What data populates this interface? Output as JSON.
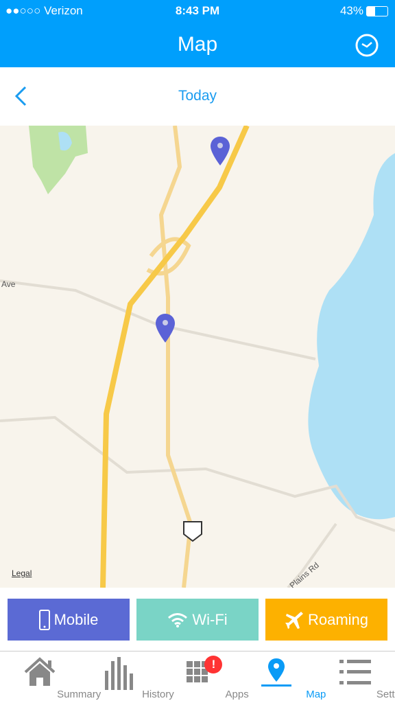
{
  "status": {
    "carrier": "●●○○○ Verizon",
    "time": "8:43 PM",
    "battery": "43%"
  },
  "nav": {
    "title": "Map",
    "right_icon": "clock-icon"
  },
  "datebar": {
    "label": "Today"
  },
  "map": {
    "labels": {
      "ave": "Ave",
      "legal": "Legal",
      "road": "Plains Rd"
    },
    "pin_color": "#5b62d6",
    "water_color": "#aee0f5"
  },
  "buttons": [
    {
      "label": "Mobile",
      "icon": "phone-icon",
      "color": "#5b6ad4"
    },
    {
      "label": "Wi-Fi",
      "icon": "wifi-icon",
      "color": "#7ad4c6"
    },
    {
      "label": "Roaming",
      "icon": "airplane-icon",
      "color": "#fdb100"
    }
  ],
  "tabs": [
    {
      "label": "Summary",
      "icon": "home-icon"
    },
    {
      "label": "History",
      "icon": "bar-chart-icon"
    },
    {
      "label": "Apps",
      "icon": "grid-icon",
      "badge": "!"
    },
    {
      "label": "Map",
      "icon": "map-pin-icon",
      "active": true
    },
    {
      "label": "Settings",
      "icon": "list-icon"
    }
  ]
}
